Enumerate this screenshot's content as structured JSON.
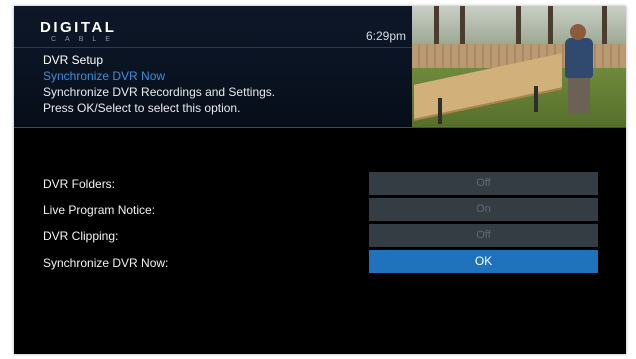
{
  "brand": {
    "title": "DIGITAL",
    "subtitle": "CABLE"
  },
  "clock": "6:29pm",
  "header": {
    "title": "DVR Setup",
    "selected_item": "Synchronize DVR Now",
    "description": "Synchronize DVR Recordings and Settings.",
    "hint": "Press OK/Select to select this option."
  },
  "settings": [
    {
      "label": "DVR Folders:",
      "value": "Off",
      "selected": false
    },
    {
      "label": "Live Program Notice:",
      "value": "On",
      "selected": false
    },
    {
      "label": "DVR Clipping:",
      "value": "Off",
      "selected": false
    },
    {
      "label": "Synchronize DVR Now:",
      "value": "OK",
      "selected": true
    }
  ],
  "colors": {
    "background": "#000000",
    "header": "#0b1424",
    "highlight_text": "#3d8fdb",
    "selected_value": "#1f73bd",
    "inactive_value": "#343c44"
  }
}
